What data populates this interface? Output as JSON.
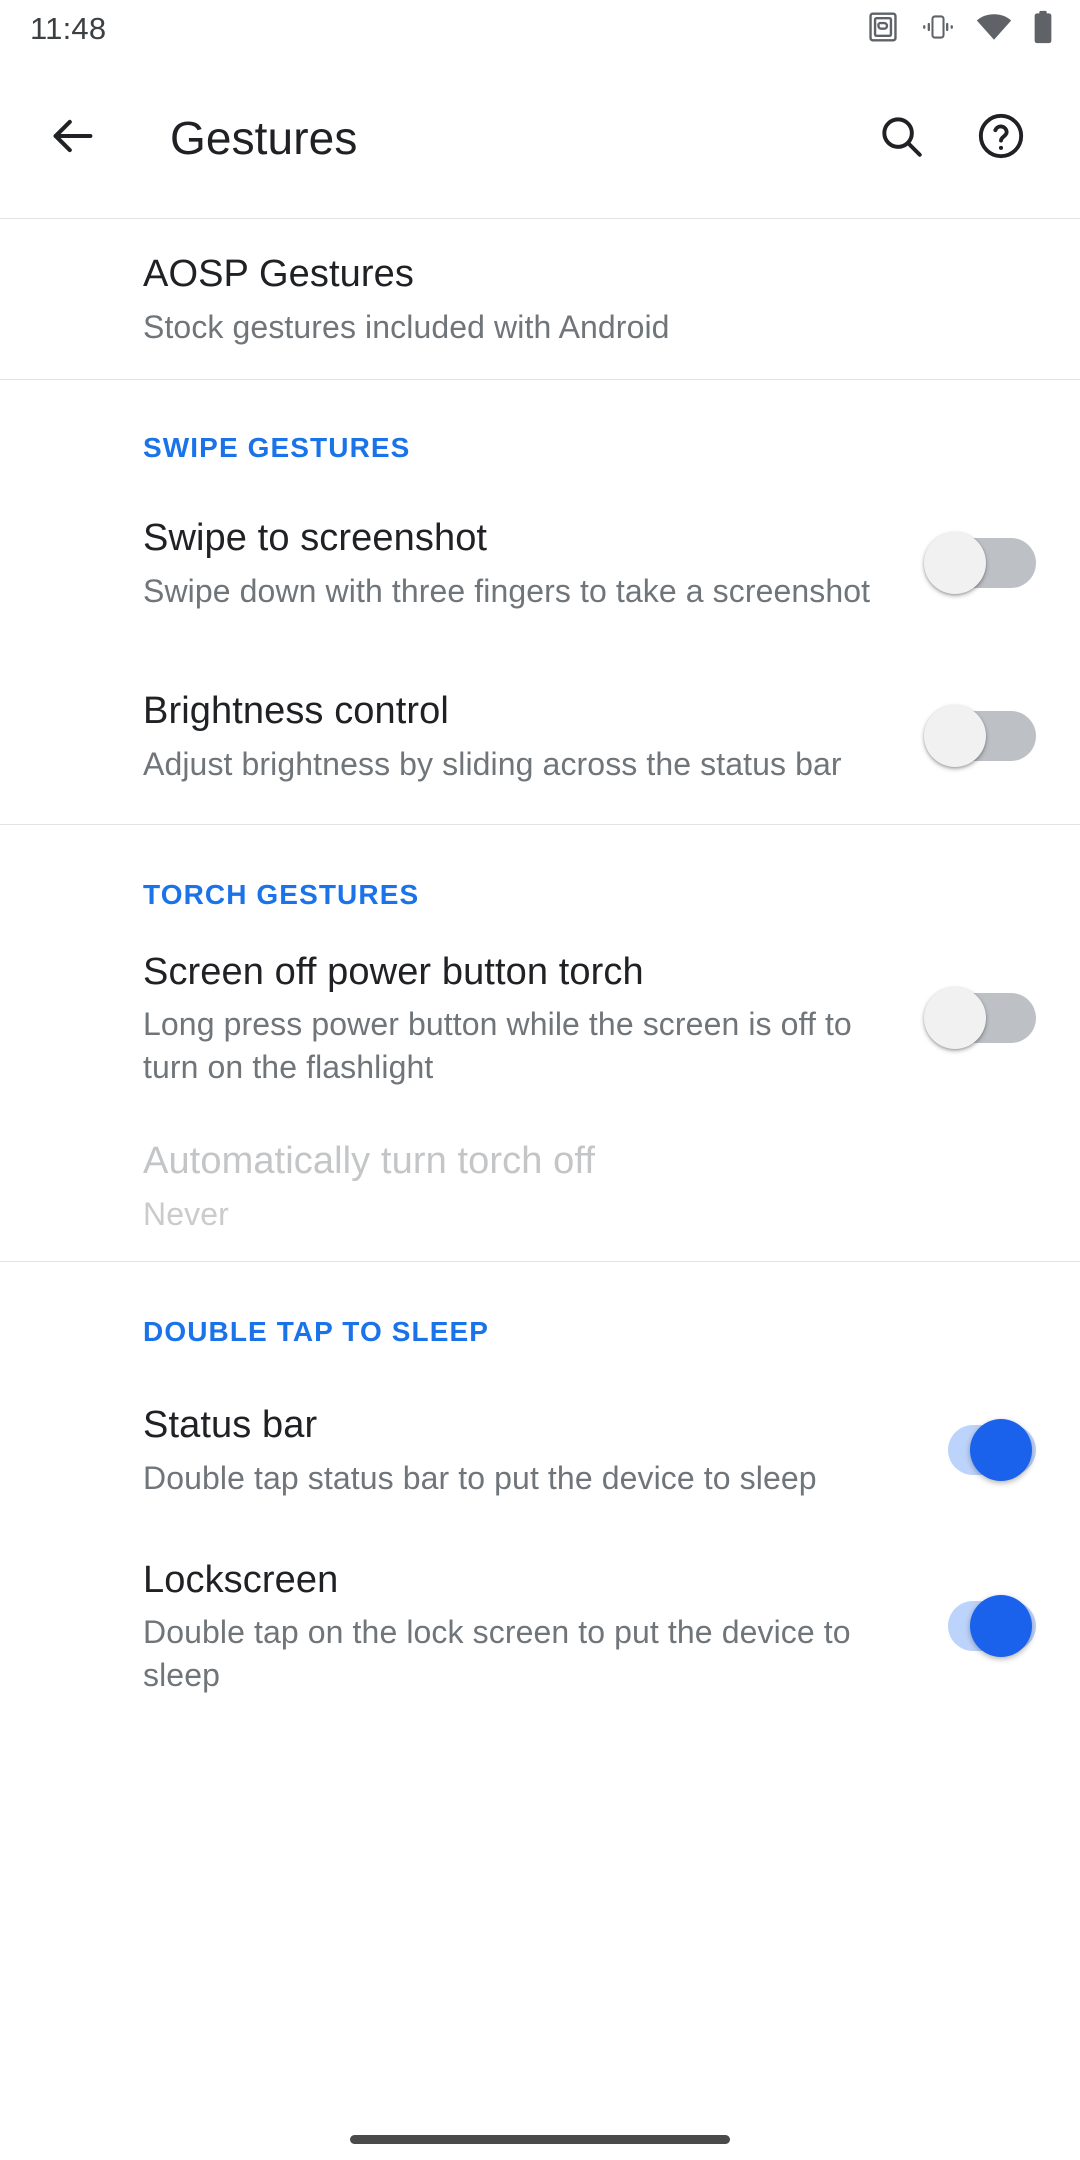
{
  "status_bar": {
    "clock": "11:48",
    "icons": [
      "screenshot-icon",
      "vibrate-icon",
      "wifi-icon",
      "battery-icon"
    ]
  },
  "app_bar": {
    "back_icon": "back-arrow-icon",
    "title": "Gestures",
    "search_icon": "search-icon",
    "help_icon": "help-circle-icon"
  },
  "colors": {
    "accent": "#1a73e8",
    "switch_on": "#1a62ec",
    "switch_on_track": "#bcd3fb",
    "switch_off_track": "#bdc1c6",
    "title": "#202124",
    "subtitle": "#70757a",
    "disabled": "#c3c5c7"
  },
  "top_item": {
    "title": "AOSP Gestures",
    "subtitle": "Stock gestures included with Android"
  },
  "sections": [
    {
      "header": "SWIPE GESTURES",
      "items": [
        {
          "title": "Swipe to screenshot",
          "subtitle": "Swipe down with three fingers to take a screenshot",
          "switch": "off",
          "enabled": true
        },
        {
          "title": "Brightness control",
          "subtitle": "Adjust brightness by sliding across the status bar",
          "switch": "off",
          "enabled": true
        }
      ]
    },
    {
      "header": "TORCH GESTURES",
      "items": [
        {
          "title": "Screen off power button torch",
          "subtitle": "Long press power button while the screen is off to turn on the flashlight",
          "switch": "off",
          "enabled": true
        },
        {
          "title": "Automatically turn torch off",
          "subtitle": "Never",
          "switch": null,
          "enabled": false
        }
      ]
    },
    {
      "header": "DOUBLE TAP TO SLEEP",
      "items": [
        {
          "title": "Status bar",
          "subtitle": "Double tap status bar to put the device to sleep",
          "switch": "on",
          "enabled": true
        },
        {
          "title": "Lockscreen",
          "subtitle": "Double tap on the lock screen to put the device to sleep",
          "switch": "on",
          "enabled": true
        }
      ]
    }
  ]
}
